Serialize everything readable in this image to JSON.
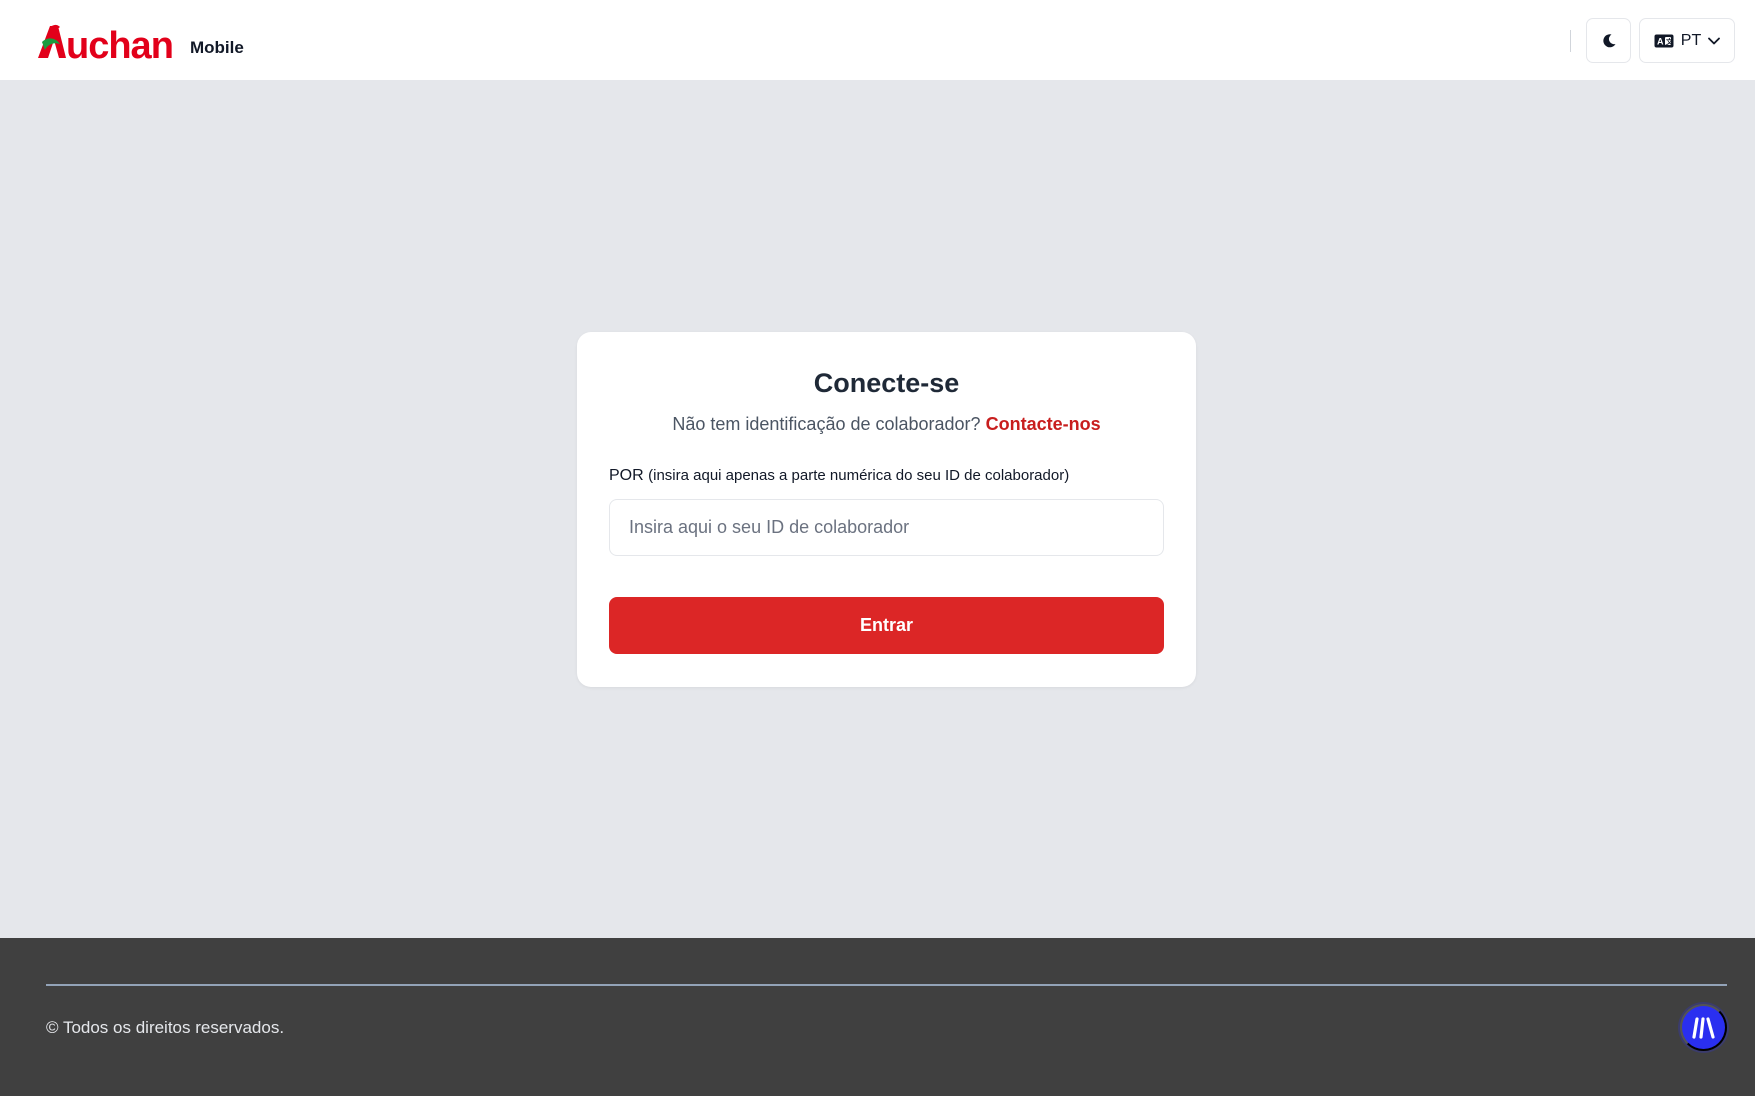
{
  "header": {
    "brand_name": "Auchan",
    "brand_suffix": "Mobile",
    "theme_toggle_icon": "moon-icon",
    "language_icon": "language-icon",
    "language_code": "PT",
    "language_chevron_icon": "chevron-down-icon"
  },
  "login_card": {
    "title": "Conecte-se",
    "subtitle_text": "Não tem identificação de colaborador?",
    "contact_link": "Contacte-nos",
    "field_label_prefix": "POR",
    "field_label_hint": "(insira aqui apenas a parte numérica do seu ID de colaborador)",
    "input_placeholder": "Insira aqui o seu ID de colaborador",
    "input_value": "",
    "submit_label": "Entrar"
  },
  "footer": {
    "copyright": "© Todos os direitos reservados.",
    "fab_icon": "brand-stripes-icon"
  },
  "colors": {
    "brand_red": "#dc2626",
    "link_red": "#c81e1e",
    "background": "#e5e7eb",
    "footer_bg": "#404040",
    "fab_blue": "#2a2ff0"
  }
}
